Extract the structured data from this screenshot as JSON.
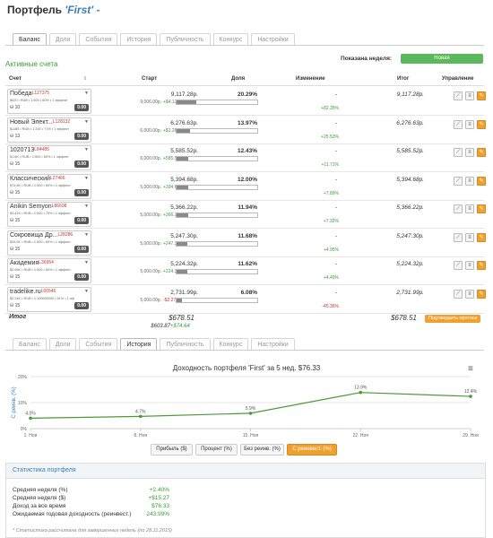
{
  "page": {
    "title_prefix": "Портфель",
    "title_name": "'First'",
    "title_suffix": "-"
  },
  "tabs_top": [
    {
      "label": "Баланс",
      "active": true
    },
    {
      "label": "Доли",
      "active": false
    },
    {
      "label": "События",
      "active": false
    },
    {
      "label": "История",
      "active": false
    },
    {
      "label": "Публичность",
      "active": false
    },
    {
      "label": "Конкурс",
      "active": false
    },
    {
      "label": "Настройки",
      "active": false
    }
  ],
  "accounts_section": {
    "heading": "Активные счета",
    "shown_label": "Показана неделя:",
    "week_value": "Новая",
    "columns": {
      "account": "Счет",
      "start": "Старт",
      "share": "Доля",
      "change": "Изменение",
      "total": "Итог",
      "manage": "Управление"
    },
    "rows": [
      {
        "name": "Победа",
        "id": "L127375",
        "sub": "$520 • RUB • 1:500 • 60% • 1 эффект",
        "sub2": "10",
        "badge": "0.00",
        "start": "9,117.28р.",
        "start_sub": "9,006.00р.",
        "start_delta": "+$4.12к",
        "share": "20.29%",
        "share_fill": 20.29,
        "change_dash": "-",
        "change": "+82.35%",
        "total": "9,117.28р."
      },
      {
        "name": "Новый Элект...",
        "id": "L128132",
        "sub": "$1185 • RUB • 1:200 • 71% • 1 эффект",
        "sub2": "13",
        "badge": "0.00",
        "start": "6,276.63р.",
        "start_sub": "6,000.00р.",
        "start_delta": "+$1.28к",
        "share": "13.97%",
        "share_fill": 13.97,
        "change_dash": "-",
        "change": "+25.53%",
        "total": "6,276.63р."
      },
      {
        "name": "1020713",
        "id": "L84485",
        "sub": "$1.6K • RUB • 1:500 • 80% • 1 эффект",
        "sub2": "15",
        "badge": "0.00",
        "start": "5,585.52р.",
        "start_sub": "6,000.00р.",
        "start_delta": "+585.52р.",
        "share": "12.43%",
        "share_fill": 12.43,
        "change_dash": "-",
        "change": "+11.71%",
        "total": "5,585.52р."
      },
      {
        "name": "Классический",
        "id": "L27466",
        "sub": "$74.6K • RUB • 1:500 • 60% • 1 эффект",
        "sub2": "15",
        "badge": "0.00",
        "start": "5,394.68р.",
        "start_sub": "5,000.00р.",
        "start_delta": "+394.68р.",
        "share": "12.00%",
        "share_fill": 12.0,
        "change_dash": "-",
        "change": "+7.89%",
        "total": "5,394.68р."
      },
      {
        "name": "Anikin Semyon",
        "id": "L86698",
        "sub": "$3.42K • RUB • 1:500 • 75% • 1 эффект",
        "sub2": "15",
        "badge": "0.00",
        "start": "5,366.22р.",
        "start_sub": "5,000.00р.",
        "start_delta": "+366.22р.",
        "share": "11.94%",
        "share_fill": 11.94,
        "change_dash": "-",
        "change": "+7.32%",
        "total": "5,366.22р."
      },
      {
        "name": "Сокровища Др...",
        "id": "L28286",
        "sub": "$34.5K • RUB • 1:500 • 60% • 1 эффект",
        "sub2": "15",
        "badge": "0.00",
        "start": "5,247.30р.",
        "start_sub": "5,000.00р.",
        "start_delta": "+247.30р.",
        "share": "11.68%",
        "share_fill": 11.68,
        "change_dash": "-",
        "change": "+4.95%",
        "total": "5,247.30р."
      },
      {
        "name": "Академия",
        "id": "L36954",
        "sub": "$2.65K • RUB • 1:500 • 60% • 1 эффект",
        "sub2": "15",
        "badge": "0.00",
        "start": "5,224.32р.",
        "start_sub": "5,000.00р.",
        "start_delta": "+224.32р.",
        "share": "11.62%",
        "share_fill": 11.62,
        "change_dash": "-",
        "change": "+4.49%",
        "total": "5,224.32р."
      },
      {
        "name": "tradelike.ru",
        "id": "L66546",
        "sub": "$2.24K • RUB • 1:100000000 • 51% • 1 эф",
        "sub2": "15",
        "badge": "0.00",
        "start": "2,731.99р.",
        "start_sub": "5,000.00р.",
        "start_delta": "-$2.27к",
        "share": "6.08%",
        "share_fill": 6.08,
        "change_dash": "-",
        "change": "-45.36%",
        "total": "2,731.99р."
      }
    ],
    "totals": {
      "label": "Итог",
      "start": "$678.51",
      "start_sub": "$603.87",
      "start_delta": "+$74.64",
      "total": "$678.51",
      "propose_btn": "Подтвердить прогноз"
    }
  },
  "tabs_bottom": [
    {
      "label": "Баланс",
      "active": false
    },
    {
      "label": "Доли",
      "active": false
    },
    {
      "label": "События",
      "active": false
    },
    {
      "label": "История",
      "active": true
    },
    {
      "label": "Публичность",
      "active": false
    },
    {
      "label": "Конкурс",
      "active": false
    },
    {
      "label": "Настройки",
      "active": false
    }
  ],
  "chart_data": {
    "type": "line",
    "title": "Доходность портфеля 'First' за 5 нед. $76.33",
    "ylabel": "С реинв. (%)",
    "categories": [
      "1. Ноя",
      "8. Ноя",
      "15. Ноя",
      "22. Ноя",
      "29. Ноя"
    ],
    "x": [
      1,
      8,
      15,
      22,
      29
    ],
    "values": [
      4.0,
      4.7,
      5.9,
      13.9,
      12.4
    ],
    "data_labels": [
      "4.0%",
      "4.7%",
      "5.9%",
      "13.9%",
      "12.4%"
    ],
    "y_ticks": [
      "0%",
      "10%",
      "20%"
    ],
    "ylim": [
      0,
      20
    ],
    "xlim": [
      1,
      29
    ],
    "color": "#4a9a3a",
    "grid": true
  },
  "mode_buttons": [
    {
      "label": "Прибыль ($)",
      "active": false
    },
    {
      "label": "Процент (%)",
      "active": false
    },
    {
      "label": "Без реинв. (%)",
      "active": false
    },
    {
      "label": "С реинвест. (%)",
      "active": true
    }
  ],
  "stats": {
    "heading": "Статистика портфеля",
    "items": [
      {
        "label": "Средняя неделя (%)",
        "value": "+2.40%",
        "color": "#3a9a3a"
      },
      {
        "label": "Средняя неделя ($)",
        "value": "+$15.27",
        "color": "#3a9a3a"
      },
      {
        "label": "Доход за все время",
        "value": "$76.33",
        "color": "#3a9a3a"
      },
      {
        "label": "Ожидаемая годовая доходность (реинвест.)",
        "value": "243.99%",
        "color": "#3a9a3a"
      }
    ],
    "note": "* Статистика рассчитана для завершенных недель (по 28.11.2015)"
  }
}
